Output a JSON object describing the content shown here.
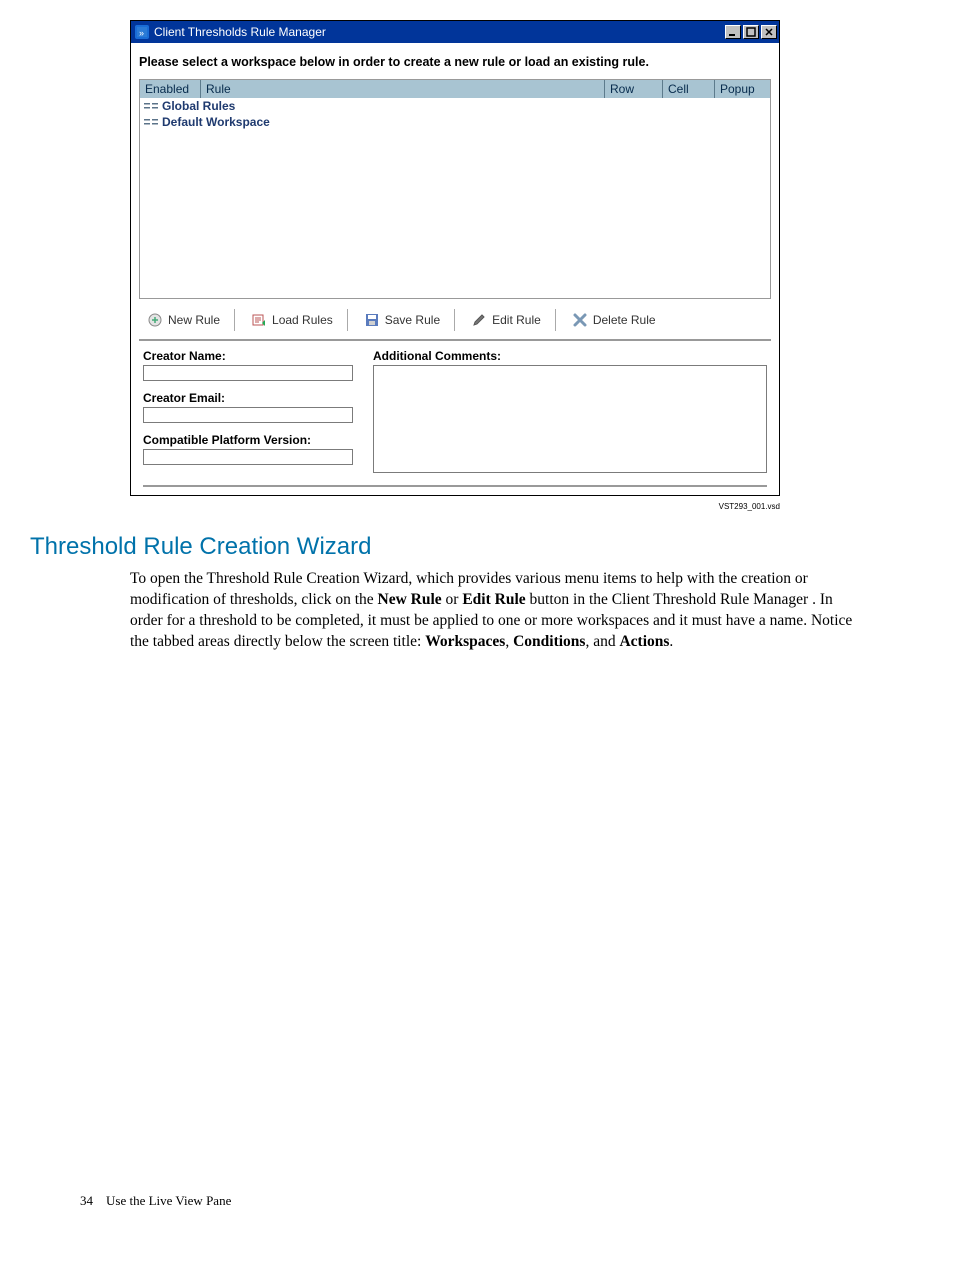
{
  "window": {
    "title": "Client Thresholds Rule Manager",
    "instruction": "Please select a workspace below in order to create a new rule or load an existing rule.",
    "columns": {
      "enabled": "Enabled",
      "rule": "Rule",
      "row": "Row",
      "cell": "Cell",
      "popup": "Popup"
    },
    "rows": {
      "global": "Global Rules",
      "default_ws": "Default Workspace"
    },
    "toolbar": {
      "new_rule": "New Rule",
      "load_rules": "Load Rules",
      "save_rule": "Save Rule",
      "edit_rule": "Edit Rule",
      "delete_rule": "Delete Rule"
    },
    "form": {
      "creator_name_label": "Creator Name:",
      "creator_email_label": "Creator Email:",
      "compat_label": "Compatible Platform Version:",
      "additional_comments_label": "Additional Comments:"
    },
    "vsd_caption": "VST293_001.vsd"
  },
  "doc": {
    "heading": "Threshold Rule Creation Wizard",
    "p_a": "To open the Threshold Rule Creation Wizard, which provides various menu items to help with the creation or modification of thresholds, click on the ",
    "p_b_new": "New Rule",
    "p_c": " or ",
    "p_d_edit": "Edit Rule",
    "p_e": " button in the Client Threshold Rule Manager . In order for a threshold to be completed, it must be applied to one or more workspaces and it must have a name. Notice the tabbed areas directly below the screen title: ",
    "p_f_ws": "Workspaces",
    "p_g": ", ",
    "p_h_cond": "Conditions",
    "p_i": ", and ",
    "p_j_act": "Actions",
    "p_k": ".",
    "page_num": "34",
    "footer_text": "Use the Live View Pane"
  }
}
